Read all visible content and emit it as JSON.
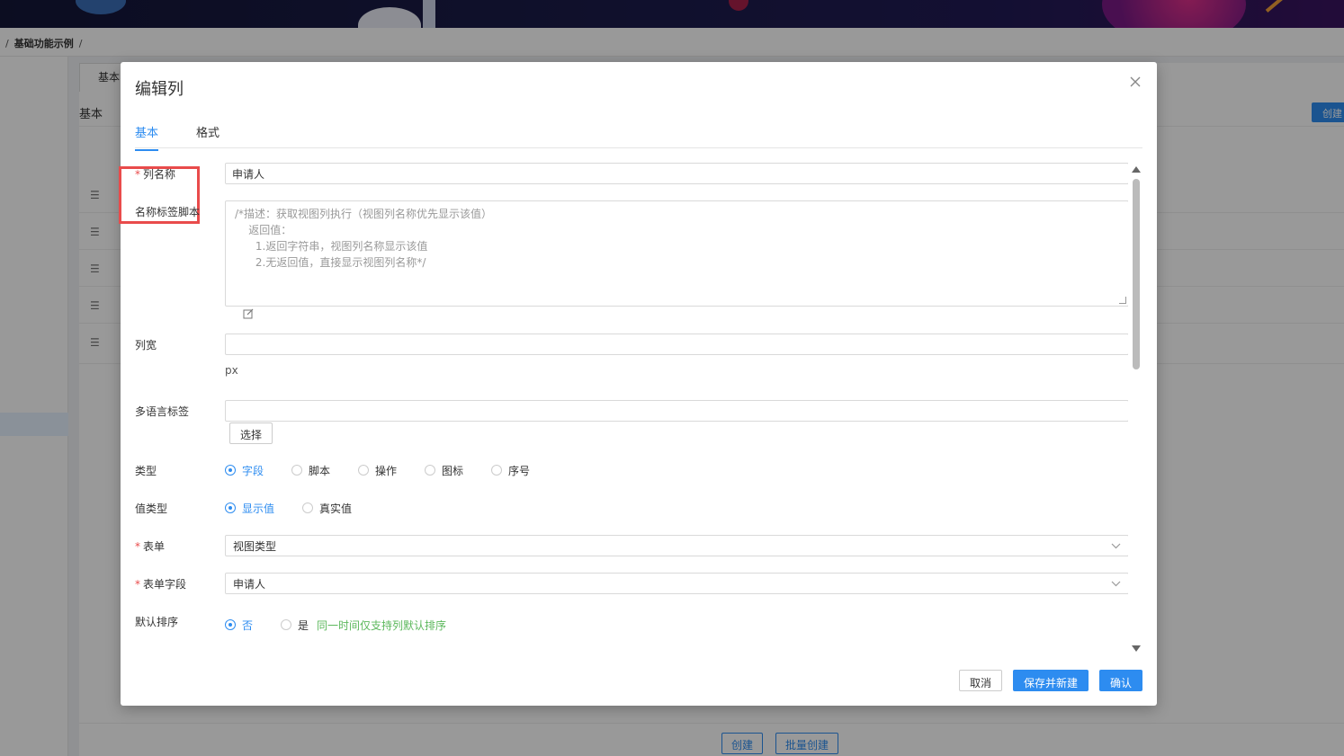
{
  "breadcrumb": {
    "sep1": "/",
    "current": "基础功能示例",
    "sep2": "/"
  },
  "background": {
    "tab_label": "基本",
    "section_title": "基本",
    "create_label": "创建",
    "footer_create": "创建",
    "footer_batch_create": "批量创建",
    "row_icon": "☰"
  },
  "modal": {
    "title": "编辑列",
    "tabs": [
      {
        "label": "基本",
        "active": true
      },
      {
        "label": "格式",
        "active": false
      }
    ],
    "form": {
      "column_name": {
        "required_mark": "*",
        "label": "列名称",
        "value": "申请人"
      },
      "name_script": {
        "label": "名称标签脚本",
        "placeholder": "/*描述：获取视图列执行（视图列名称优先显示该值）\n    返回值：\n      1.返回字符串，视图列名称显示该值\n      2.无返回值，直接显示视图列名称*/"
      },
      "column_width": {
        "label": "列宽",
        "value": "",
        "unit": "px"
      },
      "i18n_label": {
        "label": "多语言标签",
        "value": "",
        "button": "选择"
      },
      "type": {
        "label": "类型",
        "options": [
          "字段",
          "脚本",
          "操作",
          "图标",
          "序号"
        ],
        "selected": "字段"
      },
      "value_type": {
        "label": "值类型",
        "options": [
          "显示值",
          "真实值"
        ],
        "selected": "显示值"
      },
      "form_select": {
        "required_mark": "*",
        "label": "表单",
        "value": "视图类型"
      },
      "form_field": {
        "required_mark": "*",
        "label": "表单字段",
        "value": "申请人"
      },
      "default_sort": {
        "label": "默认排序",
        "options": [
          "否",
          "是"
        ],
        "selected": "否",
        "hint": "同一时间仅支持列默认排序"
      }
    },
    "footer": {
      "cancel": "取消",
      "save_new": "保存并新建",
      "confirm": "确认"
    }
  },
  "colors": {
    "accent": "#2d8cf0",
    "required": "#e94b4b",
    "hint": "#5cb85c",
    "highlight": "#e94b4b"
  }
}
